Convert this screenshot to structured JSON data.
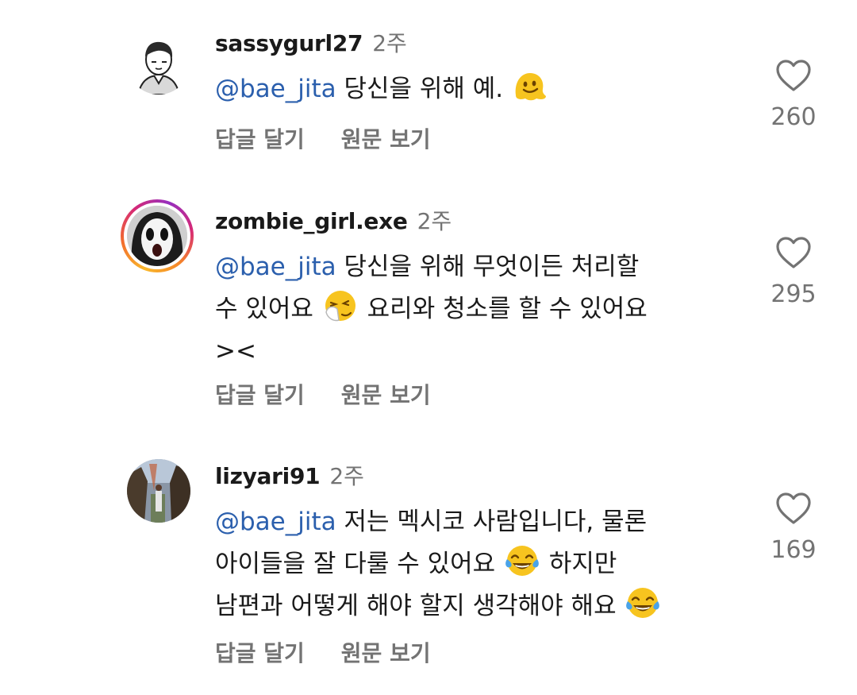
{
  "comments": [
    {
      "username": "sassygurl27",
      "age": "2주",
      "mention": "@bae_jita",
      "lines": [
        "당신을 위해 예."
      ],
      "emoji": [
        "melting-face"
      ],
      "likes": "260",
      "reply_label": "답글 달기",
      "translate_label": "원문 보기"
    },
    {
      "username": "zombie_girl.exe",
      "age": "2주",
      "mention": "@bae_jita",
      "text_line1": "당신을 위해 무엇이든 처리할",
      "text_line2a": "수 있어요",
      "text_line2b": "요리와 청소를 할 수 있어요",
      "text_line3": "><",
      "emoji": [
        "sneezing-face"
      ],
      "likes": "295",
      "reply_label": "답글 달기",
      "translate_label": "원문 보기"
    },
    {
      "username": "lizyari91",
      "age": "2주",
      "mention": "@bae_jita",
      "text_line1": "저는 멕시코 사람입니다, 물론",
      "text_line2a": "아이들을 잘 다룰 수 있어요",
      "text_line2b": "하지만",
      "text_line3": "남편과 어떻게 해야 할지 생각해야 해요",
      "emoji": [
        "face-with-tears-of-joy",
        "face-with-tears-of-joy"
      ],
      "likes": "169",
      "reply_label": "답글 달기",
      "translate_label": "원문 보기"
    }
  ],
  "colors": {
    "mention": "#2b5fad",
    "secondary_text": "#737373",
    "story_ring_start": "#f9b72b",
    "story_ring_end": "#d62976"
  },
  "icons": [
    "heart-outline-icon",
    "melting-face-emoji",
    "sneezing-face-emoji",
    "tears-of-joy-emoji"
  ]
}
